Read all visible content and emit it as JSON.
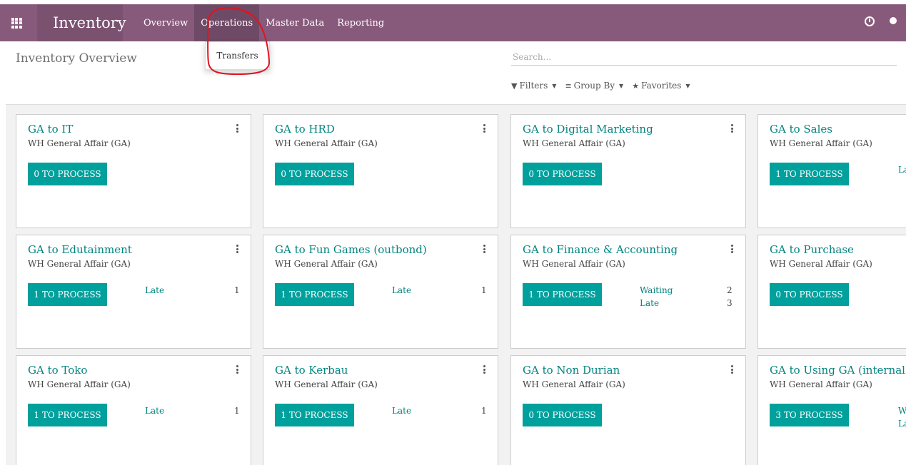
{
  "app": {
    "title": "Inventory",
    "menu": [
      "Overview",
      "Operations",
      "Master Data",
      "Reporting"
    ]
  },
  "dropdown": {
    "item": "Transfers"
  },
  "breadcrumb": "Inventory Overview",
  "search": {
    "placeholder": "Search..."
  },
  "filters": {
    "filters": "Filters",
    "group_by": "Group By",
    "favorites": "Favorites"
  },
  "cards": [
    {
      "title": "GA to IT",
      "subtitle": "WH General Affair (GA)",
      "button": "0 TO PROCESS"
    },
    {
      "title": "GA to HRD",
      "subtitle": "WH General Affair (GA)",
      "button": "0 TO PROCESS"
    },
    {
      "title": "GA to Digital Marketing",
      "subtitle": "WH General Affair (GA)",
      "button": "0 TO PROCESS"
    },
    {
      "title": "GA to Sales",
      "subtitle": "WH General Affair (GA)",
      "button": "1 TO PROCESS",
      "partial_stat": "La"
    },
    {
      "title": "GA to Edutainment",
      "subtitle": "WH General Affair (GA)",
      "button": "1 TO PROCESS",
      "stats": [
        {
          "label": "Late",
          "value": "1"
        }
      ]
    },
    {
      "title": "GA to Fun Games (outbond)",
      "subtitle": "WH General Affair (GA)",
      "button": "1 TO PROCESS",
      "stats": [
        {
          "label": "Late",
          "value": "1"
        }
      ]
    },
    {
      "title": "GA to Finance & Accounting",
      "subtitle": "WH General Affair (GA)",
      "button": "1 TO PROCESS",
      "stats": [
        {
          "label": "Waiting",
          "value": "2"
        },
        {
          "label": "Late",
          "value": "3"
        }
      ]
    },
    {
      "title": "GA to Purchase",
      "subtitle": "WH General Affair (GA)",
      "button": "0 TO PROCESS"
    },
    {
      "title": "GA to Toko",
      "subtitle": "WH General Affair (GA)",
      "button": "1 TO PROCESS",
      "stats": [
        {
          "label": "Late",
          "value": "1"
        }
      ]
    },
    {
      "title": "GA to Kerbau",
      "subtitle": "WH General Affair (GA)",
      "button": "1 TO PROCESS",
      "stats": [
        {
          "label": "Late",
          "value": "1"
        }
      ]
    },
    {
      "title": "GA to Non Durian",
      "subtitle": "WH General Affair (GA)",
      "button": "0 TO PROCESS"
    },
    {
      "title": "GA to Using GA (internal",
      "subtitle": "WH General Affair (GA)",
      "button": "3 TO PROCESS",
      "partial_stats": [
        "W",
        "La"
      ]
    }
  ],
  "colors": {
    "brand": "#875a7b",
    "accent": "#00a09d",
    "link": "#00847f",
    "annotation": "#e0141e"
  }
}
